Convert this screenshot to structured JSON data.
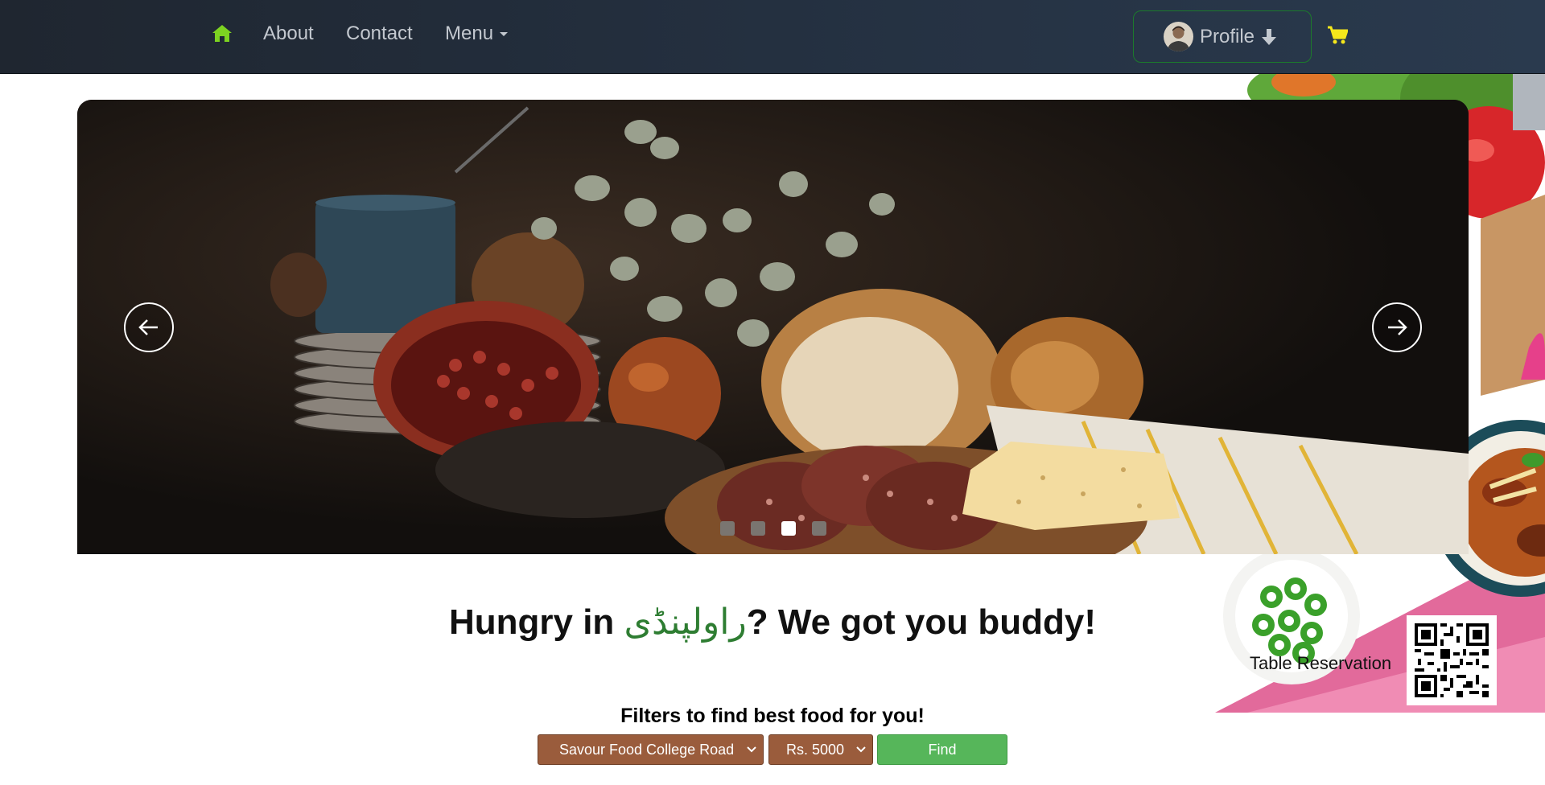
{
  "nav": {
    "home_icon": "home-icon",
    "about": "About",
    "contact": "Contact",
    "menu": "Menu",
    "profile": "Profile",
    "cart_icon": "shopping-cart-icon",
    "accent_color": "#7dd321",
    "cart_color": "#f5e71b"
  },
  "carousel": {
    "slide_count": 4,
    "active_slide": 3
  },
  "headline": {
    "prefix": "Hungry in ",
    "city": "راولپنڈی",
    "suffix": "? We got you buddy!"
  },
  "reservation": {
    "label": "Table Reservation"
  },
  "filters": {
    "title": "Filters to find best food for you!",
    "restaurant_selected": "Savour Food College Road",
    "price_selected": "Rs. 5000",
    "find_label": "Find",
    "select_color": "#9a5c3c",
    "find_color": "#56b65a"
  }
}
